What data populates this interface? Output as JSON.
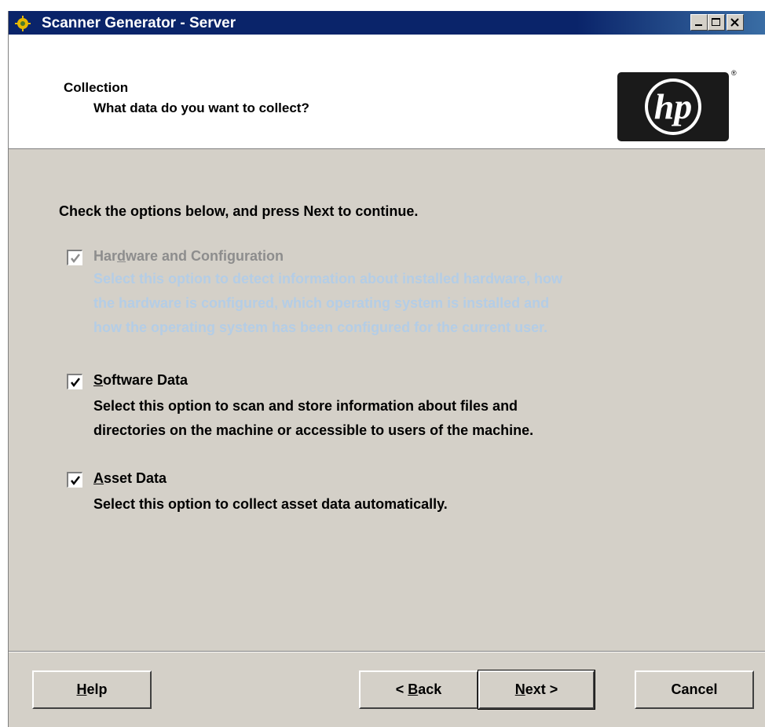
{
  "window": {
    "title": "Scanner Generator - Server",
    "icon": "gear-app-icon"
  },
  "header": {
    "title": "Collection",
    "subtitle": "What data do you want to collect?",
    "logo_text": "hp",
    "logo_mark": "®"
  },
  "instruction": "Check the options below, and press Next to continue.",
  "options": [
    {
      "label_pre": "Har",
      "label_mn": "d",
      "label_post": "ware and Configuration",
      "checked": true,
      "enabled": false,
      "desc": "Select this option to detect information about installed hardware, how\nthe hardware is configured, which operating system is installed and\nhow the operating system has been configured for the current user."
    },
    {
      "label_pre": "",
      "label_mn": "S",
      "label_post": "oftware Data",
      "checked": true,
      "enabled": true,
      "desc": "Select this option to scan and store information about files and\ndirectories on the machine or accessible to users of the machine."
    },
    {
      "label_pre": "",
      "label_mn": "A",
      "label_post": "sset Data",
      "checked": true,
      "enabled": true,
      "desc": "Select this option to collect asset data automatically."
    }
  ],
  "buttons": {
    "help": {
      "mn": "H",
      "rest": "elp"
    },
    "back": {
      "pre": "< ",
      "mn": "B",
      "rest": "ack"
    },
    "next": {
      "mn": "N",
      "rest": "ext >"
    },
    "cancel": "Cancel"
  },
  "colors": {
    "titlebar": "#0a246a",
    "dialog_bg": "#d4d0c8",
    "disabled_text": "#b4cde6"
  }
}
